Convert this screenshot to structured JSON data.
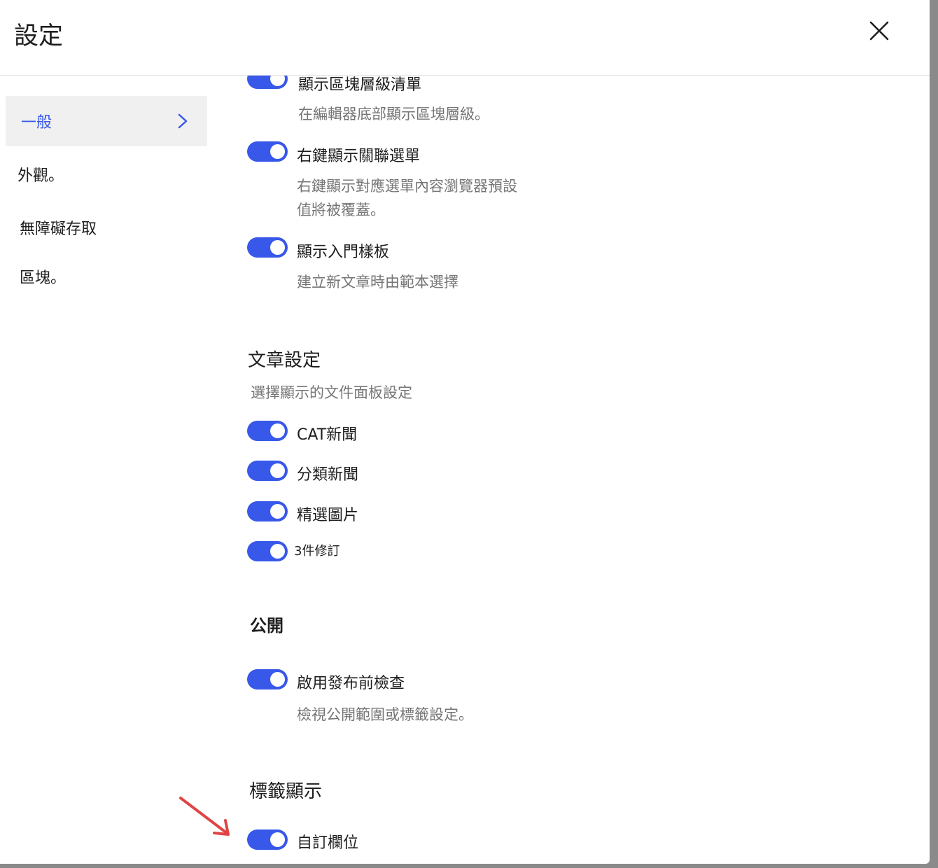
{
  "modal": {
    "title": "設定",
    "close_icon": "close-icon"
  },
  "sidebar": {
    "items": [
      {
        "label": "一般",
        "active": true
      },
      {
        "label": "外觀。",
        "active": false
      },
      {
        "label": "無障礙存取",
        "active": false
      },
      {
        "label": "區塊。",
        "active": false
      }
    ]
  },
  "general": {
    "options": [
      {
        "label": "顯示區塊層級清單",
        "help": "在編輯器底部顯示區塊層級。",
        "enabled": true
      },
      {
        "label": "右鍵顯示關聯選單",
        "help": "右鍵顯示對應選單內容瀏覽器預設值將被覆蓋。",
        "enabled": true
      },
      {
        "label": "顯示入門樣板",
        "help": "建立新文章時由範本選擇",
        "enabled": true
      }
    ]
  },
  "document_settings": {
    "title": "文章設定",
    "description": "選擇顯示的文件面板設定",
    "options": [
      {
        "label": "CAT新聞",
        "enabled": true
      },
      {
        "label": "分類新聞",
        "enabled": true
      },
      {
        "label": "精選圖片",
        "enabled": true
      },
      {
        "label": "3件修訂",
        "enabled": true
      }
    ]
  },
  "publish": {
    "title": "公開",
    "options": [
      {
        "label": "啟用發布前檢查",
        "help": "檢視公開範圍或標籤設定。",
        "enabled": true
      }
    ]
  },
  "tag_display": {
    "title": "標籤顯示",
    "options": [
      {
        "label": "自訂欄位",
        "enabled": true
      }
    ]
  },
  "colors": {
    "accent": "#3858e9",
    "annotation_arrow": "#e04444"
  }
}
